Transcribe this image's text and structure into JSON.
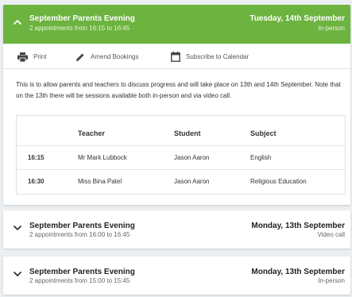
{
  "colors": {
    "accent_green": "#6db33f",
    "background": "#eceff1"
  },
  "events": [
    {
      "title": "September Parents Evening",
      "subtitle": "2 appointments from 16:15 to 16:45",
      "date": "Tuesday, 14th September",
      "mode": "In-person",
      "expanded": true,
      "chevron_icon": "chevron-up-icon"
    },
    {
      "title": "September Parents Evening",
      "subtitle": "2 appointments from 16:00 to 16:45",
      "date": "Monday, 13th September",
      "mode": "Video call",
      "expanded": false,
      "chevron_icon": "chevron-down-icon"
    },
    {
      "title": "September Parents Evening",
      "subtitle": "2 appointments from 15:00 to 15:45",
      "date": "Monday, 13th September",
      "mode": "In-person",
      "expanded": false,
      "chevron_icon": "chevron-down-icon"
    }
  ],
  "toolbar": {
    "print_label": "Print",
    "print_icon": "printer-icon",
    "amend_label": "Amend Bookings",
    "amend_icon": "pencil-icon",
    "subscribe_label": "Subscribe to Calendar",
    "subscribe_icon": "calendar-icon"
  },
  "description": "This is to allow parents and teachers to discuss progress and will take place on 13th and 14th September. Note that on the 13th there will be sessions available both in-person and via video call.",
  "table": {
    "headers": {
      "time": "",
      "teacher": "Teacher",
      "student": "Student",
      "subject": "Subject"
    },
    "rows": [
      {
        "time": "16:15",
        "teacher": "Mr Mark Lubbock",
        "student": "Jason Aaron",
        "subject": "English"
      },
      {
        "time": "16:30",
        "teacher": "Miss Bina Patel",
        "student": "Jason Aaron",
        "subject": "Religious Education"
      }
    ]
  }
}
